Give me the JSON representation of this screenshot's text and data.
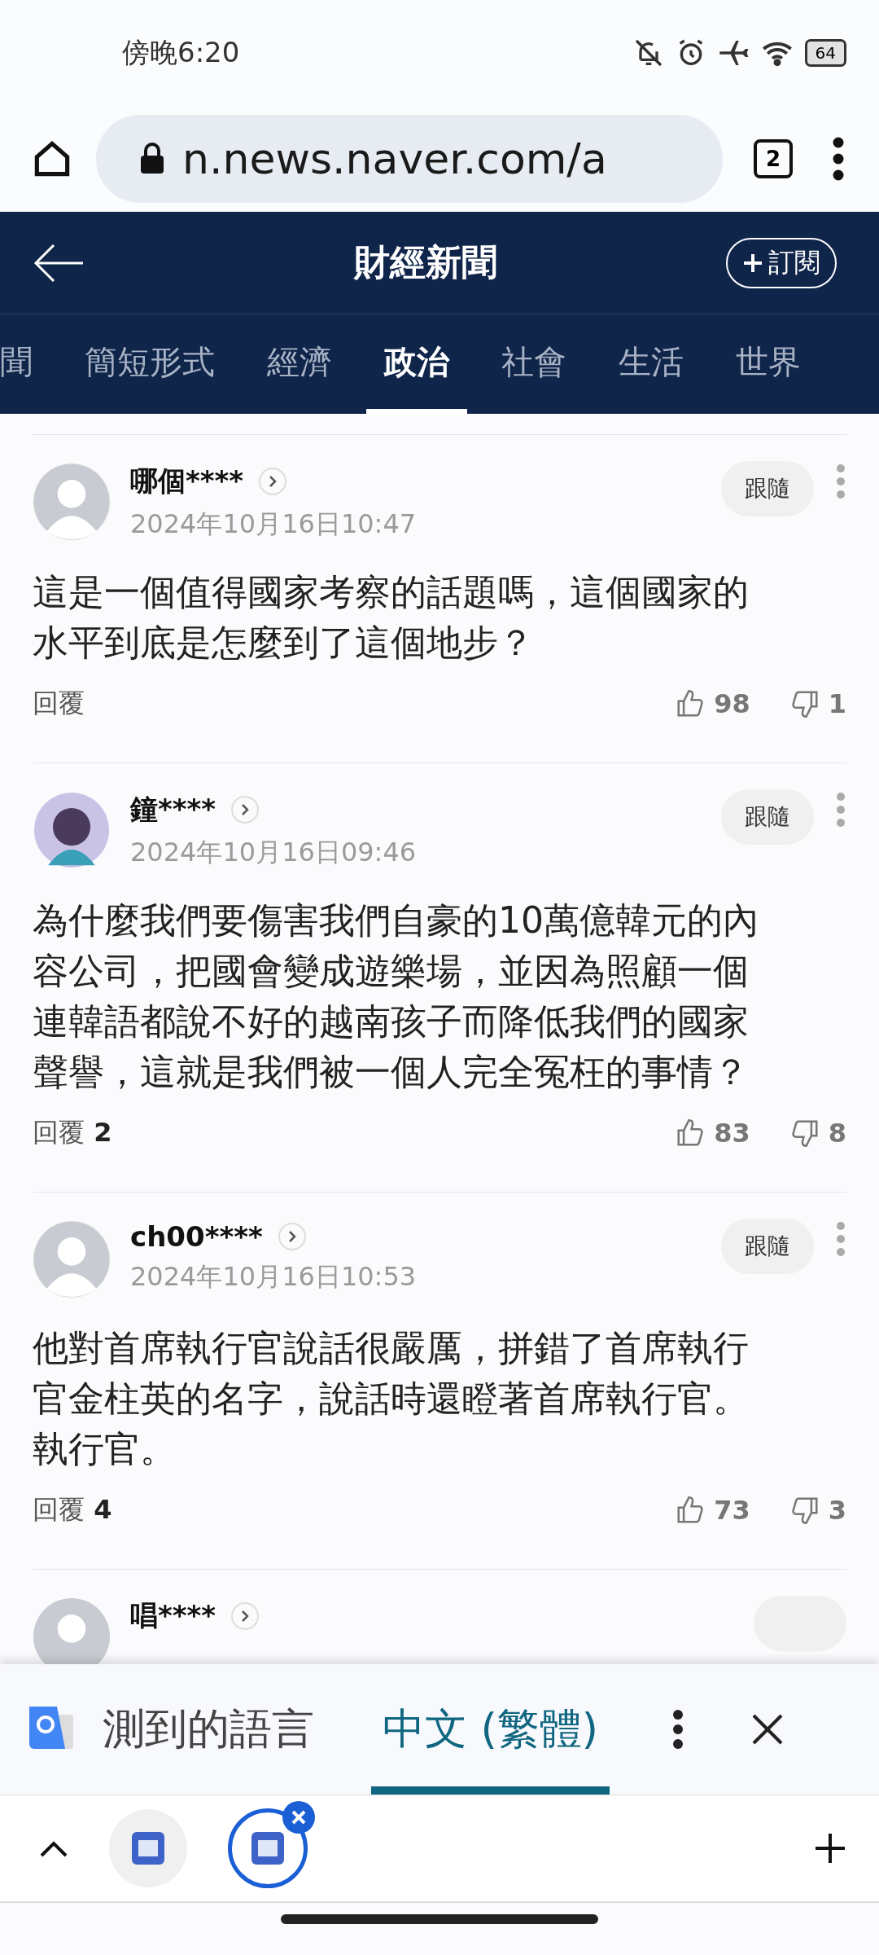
{
  "status_bar": {
    "time": "傍晚6:20",
    "battery": "64"
  },
  "browser": {
    "url": "n.news.naver.com/a",
    "tab_count": "2"
  },
  "header": {
    "title": "財經新聞",
    "subscribe_label": "訂閱"
  },
  "tabs": [
    {
      "label": "聞",
      "selected": false
    },
    {
      "label": "簡短形式",
      "selected": false
    },
    {
      "label": "經濟",
      "selected": false
    },
    {
      "label": "政治",
      "selected": true
    },
    {
      "label": "社會",
      "selected": false
    },
    {
      "label": "生活",
      "selected": false
    },
    {
      "label": "世界",
      "selected": false
    }
  ],
  "comments": [
    {
      "user": "哪個****",
      "avatar": {
        "kind": "default"
      },
      "follow_label": "跟隨",
      "date": "2024年10月16日10:47",
      "text": "這是一個值得國家考察的話題嗎，這個國家的水平到底是怎麼到了這個地步？",
      "reply_label": "回覆",
      "likes": "98",
      "dislikes": "1"
    },
    {
      "user": "鐘****",
      "avatar": {
        "kind": "custom"
      },
      "follow_label": "跟隨",
      "date": "2024年10月16日09:46",
      "text": "為什麼我們要傷害我們自豪的10萬億韓元的內容公司，把國會變成遊樂場，並因為照顧一個連韓語都說不好的越南孩子而降低我們的國家聲譽，這就是我們被一個人完全冤枉的事情？",
      "reply_label": "回覆",
      "reply_count": "2",
      "likes": "83",
      "dislikes": "8"
    },
    {
      "user": "ch00****",
      "avatar": {
        "kind": "default"
      },
      "follow_label": "跟隨",
      "date": "2024年10月16日10:53",
      "text": "他對首席執行官說話很嚴厲，拼錯了首席執行官金柱英的名字，說話時還瞪著首席執行官。執行官。",
      "reply_label": "回覆",
      "reply_count": "4",
      "likes": "73",
      "dislikes": "3"
    }
  ],
  "partial_comment": {
    "user": "唱****"
  },
  "translate_bar": {
    "languages": [
      {
        "label": "測到的語言",
        "selected": false
      },
      {
        "label": "中文 (繁體)",
        "selected": true
      }
    ]
  },
  "tab_strip": {
    "tabs": [
      {
        "selected": false
      },
      {
        "selected": true
      }
    ]
  }
}
